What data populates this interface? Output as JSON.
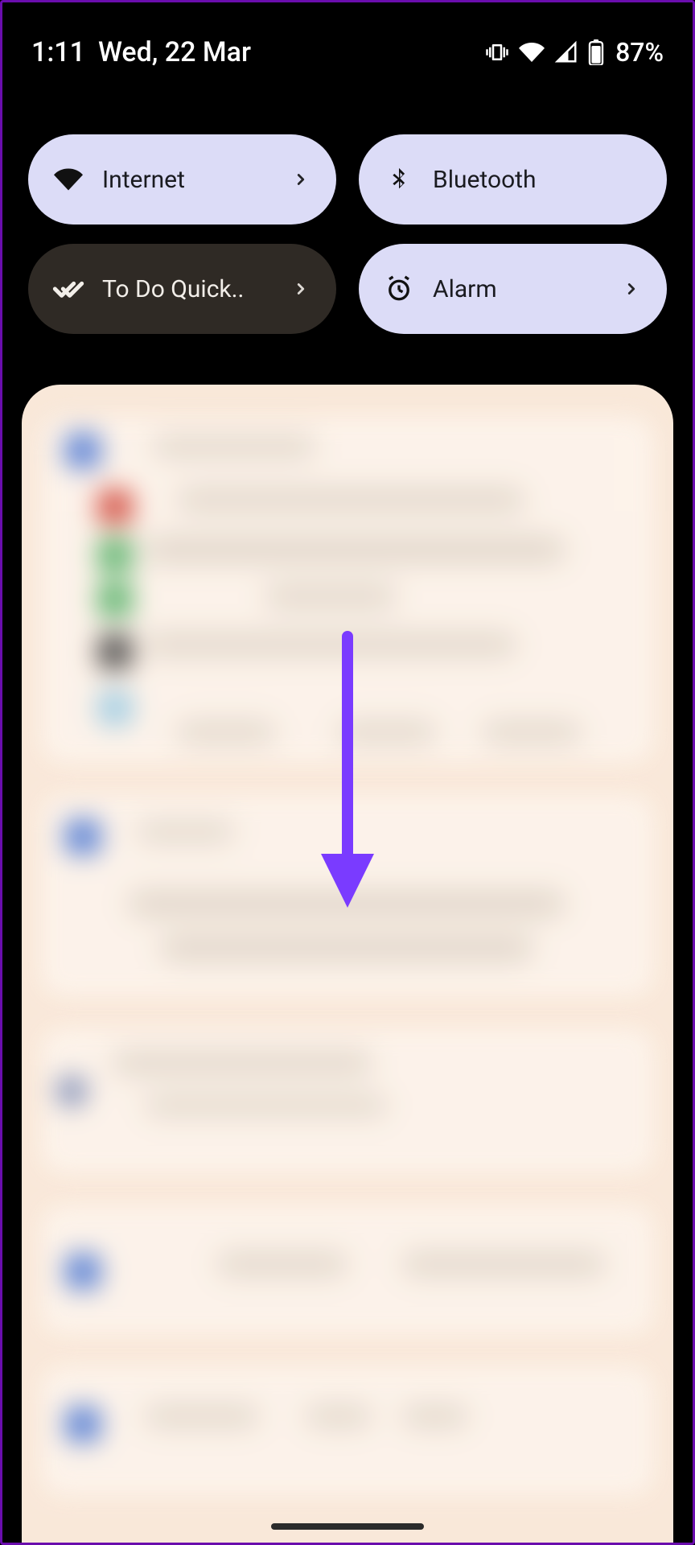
{
  "status": {
    "time": "1:11",
    "date": "Wed, 22 Mar",
    "battery_percent": "87%"
  },
  "tiles": {
    "internet": {
      "label": "Internet"
    },
    "bluetooth": {
      "label": "Bluetooth"
    },
    "todo": {
      "label": "To Do Quick.."
    },
    "alarm": {
      "label": "Alarm"
    }
  },
  "colors": {
    "tile_active": "#dcdcf7",
    "tile_inactive": "#2f2a25",
    "arrow": "#7a3bff"
  }
}
